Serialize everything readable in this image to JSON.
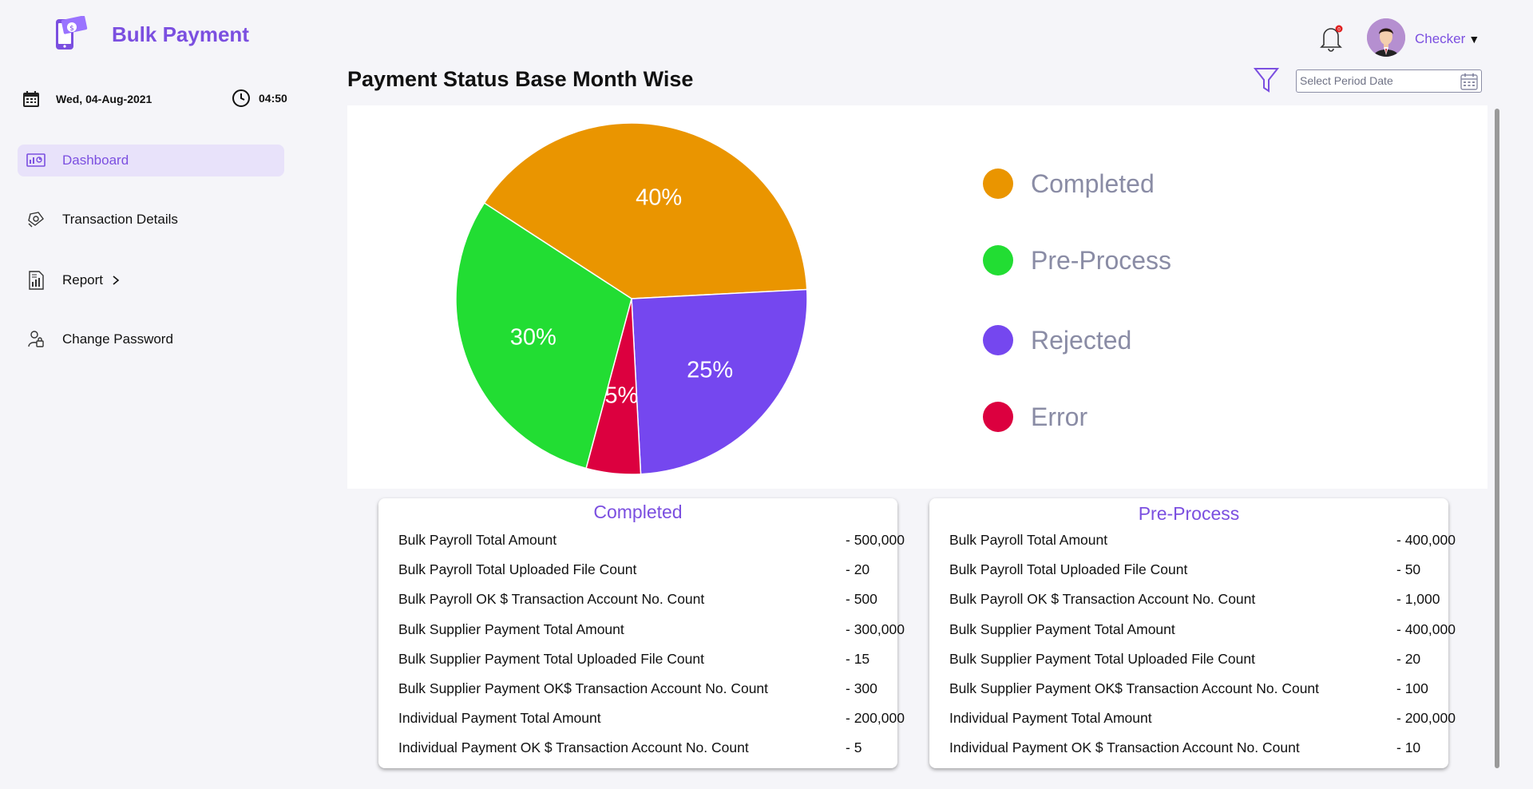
{
  "app": {
    "title": "Bulk Payment",
    "date": "Wed, 04-Aug-2021",
    "time": "04:50",
    "user": "Checker",
    "notification_count": "0"
  },
  "sidebar": {
    "items": [
      {
        "label": "Dashboard",
        "icon": "dashboard-icon",
        "active": true
      },
      {
        "label": "Transaction Details",
        "icon": "transaction-icon"
      },
      {
        "label": "Report",
        "icon": "report-icon"
      },
      {
        "label": "Change Password",
        "icon": "lock-user-icon"
      }
    ]
  },
  "main": {
    "title": "Payment Status Base Month Wise",
    "period_placeholder": "Select Period Date"
  },
  "colors": {
    "brand": "#7b4fe0",
    "completed": "#ea9500",
    "pre_process": "#22dd33",
    "rejected": "#7547ef",
    "error": "#dc003f"
  },
  "chart_data": {
    "type": "pie",
    "categories": [
      "Completed",
      "Pre-Process",
      "Rejected",
      "Error"
    ],
    "values": [
      40,
      30,
      25,
      5
    ],
    "labels": [
      "40%",
      "30%",
      "25%",
      "5%"
    ],
    "legend": [
      "Completed",
      "Pre-Process",
      "Rejected",
      "Error"
    ],
    "legend_position": "right"
  },
  "cards": {
    "completed": {
      "title": "Completed",
      "rows": [
        {
          "label": "Bulk Payroll Total Amount",
          "value": "- 500,000"
        },
        {
          "label": "Bulk Payroll Total Uploaded File Count",
          "value": "- 20"
        },
        {
          "label": "Bulk Payroll OK $ Transaction Account No. Count",
          "value": "- 500"
        },
        {
          "label": "Bulk Supplier Payment Total Amount",
          "value": "- 300,000"
        },
        {
          "label": "Bulk Supplier Payment Total Uploaded File Count",
          "value": "- 15"
        },
        {
          "label": "Bulk Supplier Payment OK$ Transaction Account No. Count",
          "value": " - 300"
        },
        {
          "label": "Individual Payment Total Amount",
          "value": "- 200,000"
        },
        {
          "label": "Individual Payment OK $ Transaction Account No. Count",
          "value": "- 5"
        }
      ]
    },
    "pre_process": {
      "title": "Pre-Process",
      "rows": [
        {
          "label": "Bulk Payroll Total Amount",
          "value": "- 400,000"
        },
        {
          "label": "Bulk Payroll Total Uploaded File Count",
          "value": "- 50"
        },
        {
          "label": "Bulk Payroll OK $ Transaction Account No. Count",
          "value": "- 1,000"
        },
        {
          "label": "Bulk Supplier Payment Total Amount",
          "value": "- 400,000"
        },
        {
          "label": "Bulk Supplier Payment Total Uploaded File Count",
          "value": "- 20"
        },
        {
          "label": "Bulk Supplier Payment OK$ Transaction Account No. Count",
          "value": " - 100"
        },
        {
          "label": "Individual Payment Total Amount",
          "value": "- 200,000"
        },
        {
          "label": "Individual Payment OK $ Transaction Account No. Count",
          "value": "- 10"
        }
      ]
    }
  }
}
